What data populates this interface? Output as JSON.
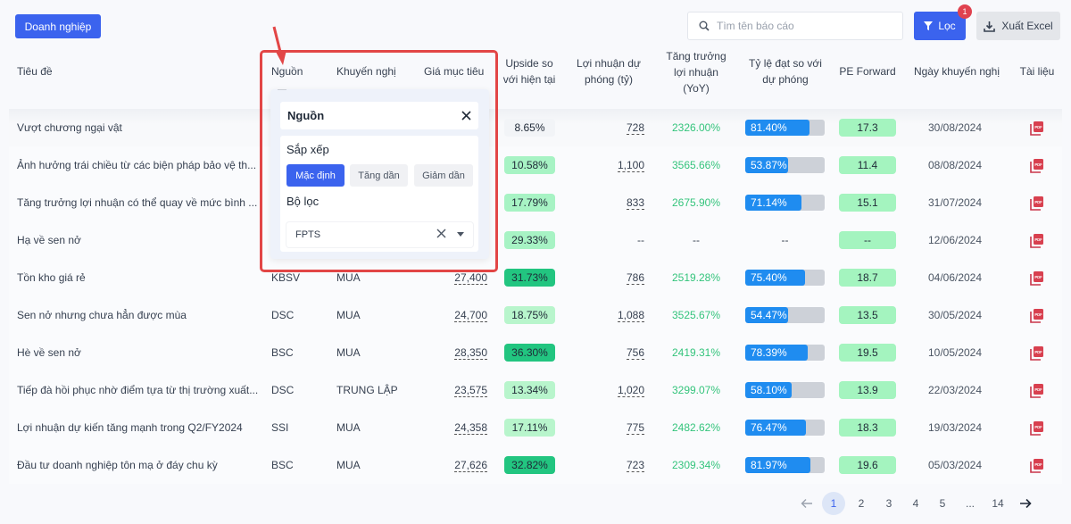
{
  "toolbar": {
    "company_button": "Doanh nghiệp",
    "search_placeholder": "Tìm tên báo cáo",
    "filter_label": "Lọc",
    "filter_badge": "1",
    "export_label": "Xuất Excel"
  },
  "columns": {
    "title": "Tiêu đề",
    "source": "Nguồn",
    "recommendation": "Khuyến nghị",
    "target_price": "Giá mục tiêu",
    "upside_l1": "Upside so",
    "upside_l2": "với hiện tại",
    "profit_l1": "Lợi nhuận dự",
    "profit_l2": "phóng (tỷ)",
    "growth_l1": "Tăng trưởng",
    "growth_l2": "lợi nhuận",
    "growth_l3": "(YoY)",
    "ratio_l1": "Tỷ lệ đạt so với",
    "ratio_l2": "dự phóng",
    "pe": "PE Forward",
    "date": "Ngày khuyến nghị",
    "doc": "Tài liệu"
  },
  "rows": [
    {
      "title": "Vượt chương ngại vật",
      "source": "",
      "recommendation": "",
      "target": "",
      "upside": "8.65%",
      "upside_level": "none",
      "profit": "728",
      "growth": "2326.00%",
      "ratio": "81.40%",
      "ratio_value": 81.4,
      "pe": "17.3",
      "date": "30/08/2024"
    },
    {
      "title": "Ảnh hưởng trái chiều từ các biện pháp bảo vệ th...",
      "source": "",
      "recommendation": "",
      "target": "",
      "upside": "10.58%",
      "upside_level": "light",
      "profit": "1,100",
      "growth": "3565.66%",
      "ratio": "53.87%",
      "ratio_value": 53.87,
      "pe": "11.4",
      "date": "08/08/2024"
    },
    {
      "title": "Tăng trưởng lợi nhuận có thể quay về mức bình ...",
      "source": "",
      "recommendation": "",
      "target": "",
      "upside": "17.79%",
      "upside_level": "light",
      "profit": "833",
      "growth": "2675.90%",
      "ratio": "71.14%",
      "ratio_value": 71.14,
      "pe": "15.1",
      "date": "31/07/2024"
    },
    {
      "title": "Hạ về sen nở",
      "source": "",
      "recommendation": "",
      "target": "",
      "upside": "29.33%",
      "upside_level": "light",
      "profit": "--",
      "growth": "--",
      "ratio": "--",
      "ratio_value": null,
      "pe": "--",
      "date": "12/06/2024"
    },
    {
      "title": "Tồn kho giá rẻ",
      "source": "KBSV",
      "recommendation": "MUA",
      "target": "27,400",
      "upside": "31.73%",
      "upside_level": "dark",
      "profit": "786",
      "growth": "2519.28%",
      "ratio": "75.40%",
      "ratio_value": 75.4,
      "pe": "18.7",
      "date": "04/06/2024"
    },
    {
      "title": "Sen nở nhưng chưa hẳn được mùa",
      "source": "DSC",
      "recommendation": "MUA",
      "target": "24,700",
      "upside": "18.75%",
      "upside_level": "mid",
      "profit": "1,088",
      "growth": "3525.67%",
      "ratio": "54.47%",
      "ratio_value": 54.47,
      "pe": "13.5",
      "date": "30/05/2024"
    },
    {
      "title": "Hè về sen nở",
      "source": "BSC",
      "recommendation": "MUA",
      "target": "28,350",
      "upside": "36.30%",
      "upside_level": "dark",
      "profit": "756",
      "growth": "2419.31%",
      "ratio": "78.39%",
      "ratio_value": 78.39,
      "pe": "19.5",
      "date": "10/05/2024"
    },
    {
      "title": "Tiếp đà hồi phục nhờ điểm tựa từ thị trường xuất...",
      "source": "DSC",
      "recommendation": "TRUNG LẬP",
      "target": "23,575",
      "upside": "13.34%",
      "upside_level": "mid",
      "profit": "1,020",
      "growth": "3299.07%",
      "ratio": "58.10%",
      "ratio_value": 58.1,
      "pe": "13.9",
      "date": "22/03/2024"
    },
    {
      "title": "Lợi nhuận dự kiến tăng mạnh trong Q2/FY2024",
      "source": "SSI",
      "recommendation": "MUA",
      "target": "24,358",
      "upside": "17.11%",
      "upside_level": "mid",
      "profit": "775",
      "growth": "2482.62%",
      "ratio": "76.47%",
      "ratio_value": 76.47,
      "pe": "18.3",
      "date": "19/03/2024"
    },
    {
      "title": "Đầu tư doanh nghiệp tôn mạ ở đáy chu kỳ",
      "source": "BSC",
      "recommendation": "MUA",
      "target": "27,626",
      "upside": "32.82%",
      "upside_level": "dark",
      "profit": "723",
      "growth": "2309.34%",
      "ratio": "81.97%",
      "ratio_value": 81.97,
      "pe": "19.6",
      "date": "05/03/2024"
    }
  ],
  "popup": {
    "title": "Nguồn",
    "sort_label": "Sắp xếp",
    "sort_options": [
      "Mặc định",
      "Tăng dần",
      "Giảm dần"
    ],
    "sort_selected": "Mặc định",
    "filter_label": "Bộ lọc",
    "filter_value": "FPTS"
  },
  "pagination": {
    "pages": [
      "1",
      "2",
      "3",
      "4",
      "5",
      "...",
      "14"
    ],
    "current": "1"
  },
  "colors": {
    "primary": "#3b63ee",
    "growth_text": "#34c47c",
    "bar_fill": "#1f8cf0",
    "highlight": "#e24646"
  }
}
